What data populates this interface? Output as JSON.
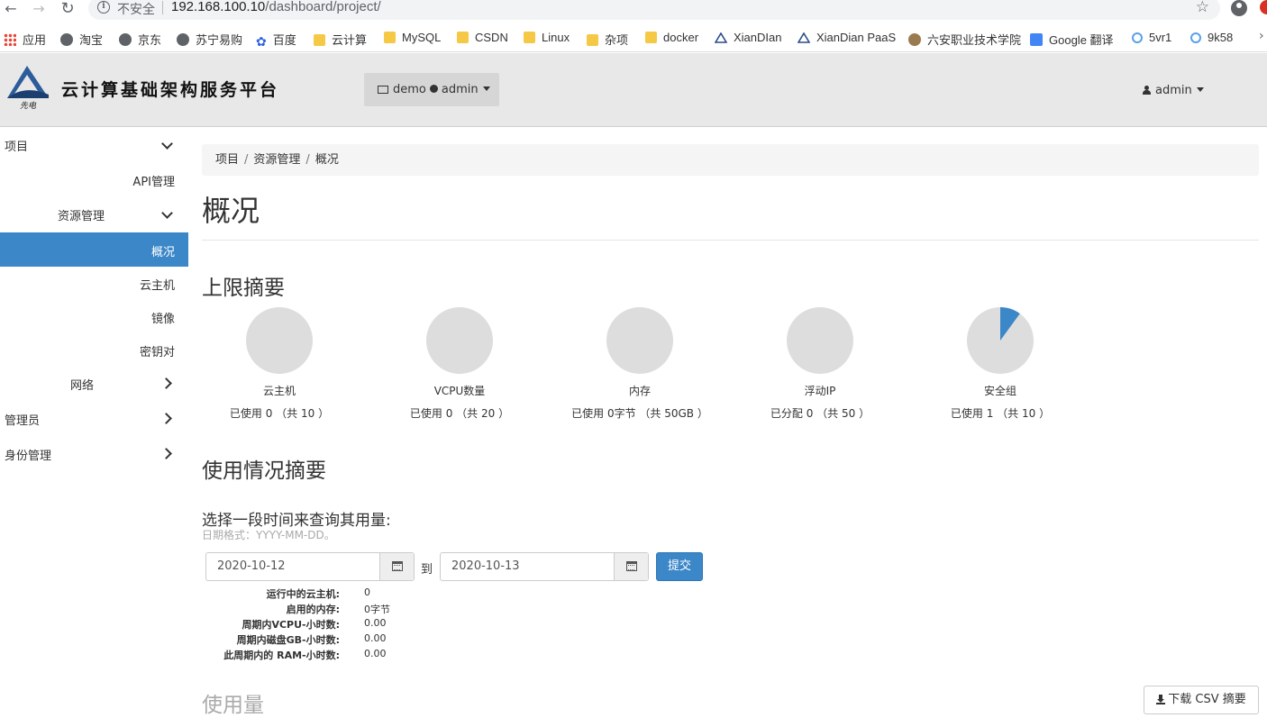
{
  "browser": {
    "security_label": "不安全",
    "url_host": "192.168.100.10",
    "url_path": "/dashboard/project/"
  },
  "bookmarks": [
    {
      "label": "应用",
      "icon": "apps-icon"
    },
    {
      "label": "淘宝",
      "icon": "globe-icon"
    },
    {
      "label": "京东",
      "icon": "globe-icon"
    },
    {
      "label": "苏宁易购",
      "icon": "globe-icon"
    },
    {
      "label": "百度",
      "icon": "paw-icon"
    },
    {
      "label": "云计算",
      "icon": "folder-icon"
    },
    {
      "label": "MySQL",
      "icon": "folder-icon"
    },
    {
      "label": "CSDN",
      "icon": "folder-icon"
    },
    {
      "label": "Linux",
      "icon": "folder-icon"
    },
    {
      "label": "杂项",
      "icon": "folder-icon"
    },
    {
      "label": "docker",
      "icon": "folder-icon"
    },
    {
      "label": "XianDIan",
      "icon": "xiandian-icon"
    },
    {
      "label": "XianDian PaaS",
      "icon": "xiandian-icon"
    },
    {
      "label": "六安职业技术学院",
      "icon": "school-icon"
    },
    {
      "label": "Google 翻译",
      "icon": "google-translate-icon"
    },
    {
      "label": "5vr1",
      "icon": "5vr1-icon"
    },
    {
      "label": "9k58",
      "icon": "9k58-icon"
    }
  ],
  "header": {
    "brand": "云计算基础架构服务平台",
    "logo_text": "先电",
    "project_dropdown": {
      "project": "demo",
      "user": "admin"
    },
    "user_menu": "admin"
  },
  "sidebar": {
    "project": "项目",
    "api": "API管理",
    "resources": "资源管理",
    "overview": "概况",
    "instances": "云主机",
    "images": "镜像",
    "keypairs": "密钥对",
    "network": "网络",
    "admin": "管理员",
    "identity": "身份管理"
  },
  "breadcrumb": [
    "项目",
    "资源管理",
    "概况"
  ],
  "page_title": "概况",
  "limits": {
    "title": "上限摘要",
    "items": [
      {
        "label": "云主机",
        "usage": "已使用 0 （共 10 ）",
        "used": 0,
        "total": 10
      },
      {
        "label": "VCPU数量",
        "usage": "已使用 0 （共 20 ）",
        "used": 0,
        "total": 20
      },
      {
        "label": "内存",
        "usage": "已使用 0字节 （共 50GB ）",
        "used": 0,
        "total": 50
      },
      {
        "label": "浮动IP",
        "usage": "已分配 0 （共 50 ）",
        "used": 0,
        "total": 50
      },
      {
        "label": "安全组",
        "usage": "已使用 1 （共 10 ）",
        "used": 1,
        "total": 10
      }
    ],
    "colors": {
      "track": "#dddddd",
      "fill": "#3b87c8"
    }
  },
  "usage_summary": {
    "title": "使用情况摘要",
    "select_label": "选择一段时间来查询其用量:",
    "date_hint": "日期格式：YYYY-MM-DD。",
    "start_date": "2020-10-12",
    "to_label": "到",
    "end_date": "2020-10-13",
    "submit": "提交",
    "stats": [
      {
        "key": "运行中的云主机:",
        "value": "0"
      },
      {
        "key": "启用的内存:",
        "value": "0字节"
      },
      {
        "key": "周期内VCPU-小时数:",
        "value": "0.00"
      },
      {
        "key": "周期内磁盘GB-小时数:",
        "value": "0.00"
      },
      {
        "key": "此周期内的 RAM-小时数:",
        "value": "0.00"
      }
    ]
  },
  "usage": {
    "title": "使用量",
    "csv_button": "下载 CSV 摘要"
  }
}
